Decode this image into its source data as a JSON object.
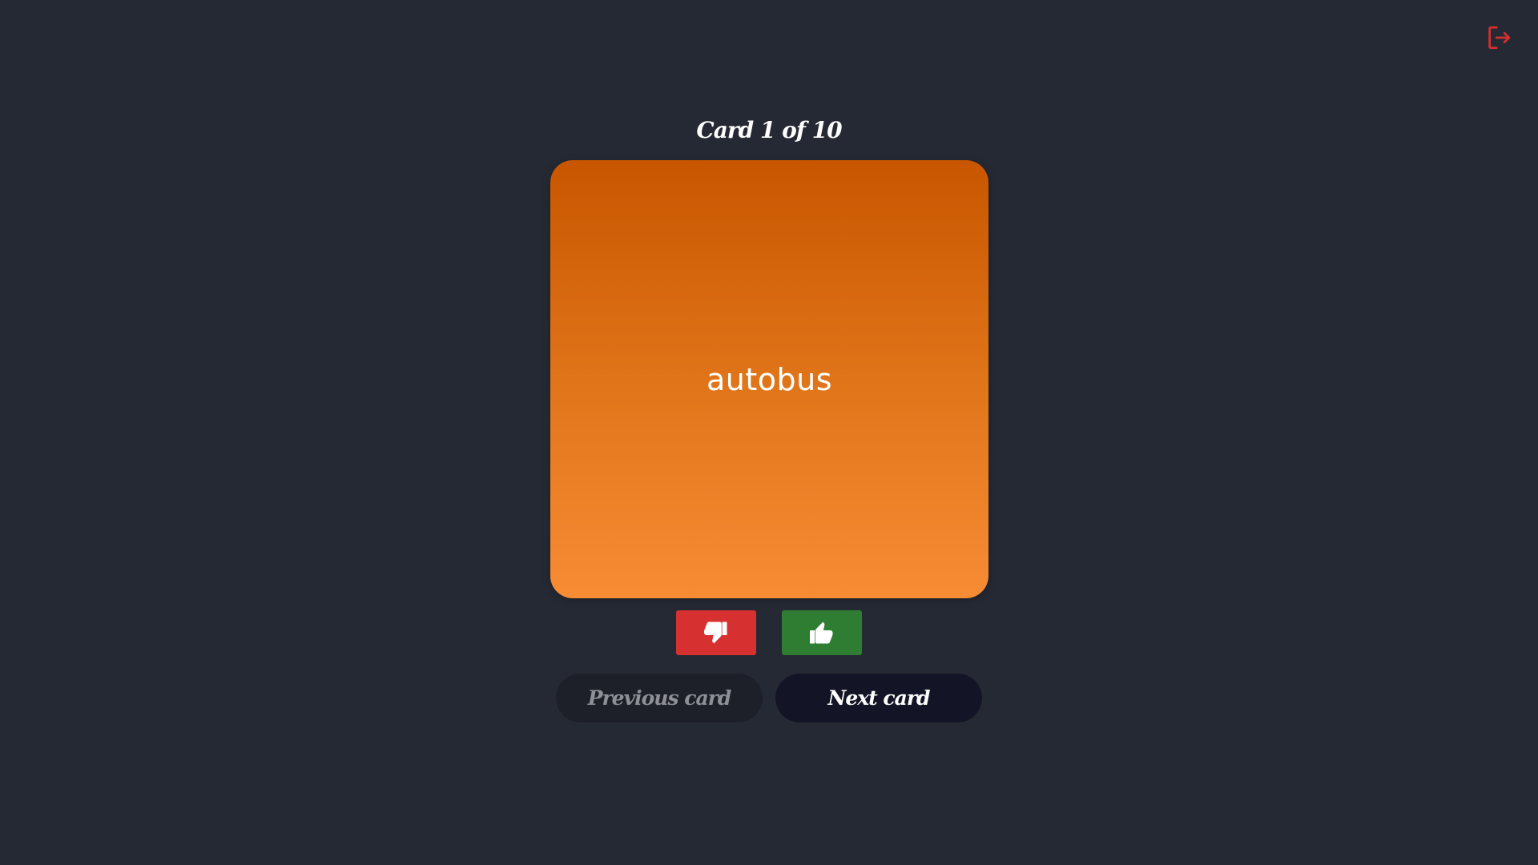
{
  "header": {
    "logout_icon": "logout-icon",
    "logout_color": "#d32f2f"
  },
  "deck": {
    "counter": "Card 1 of 10",
    "card_word": "autobus",
    "card_gradient": [
      "#c85600",
      "#f78c35"
    ]
  },
  "votes": {
    "dislike_icon": "thumbs-down-icon",
    "dislike_color": "#d63031",
    "like_icon": "thumbs-up-icon",
    "like_color": "#2e7d32"
  },
  "navigation": {
    "previous_label": "Previous card",
    "next_label": "Next card"
  }
}
